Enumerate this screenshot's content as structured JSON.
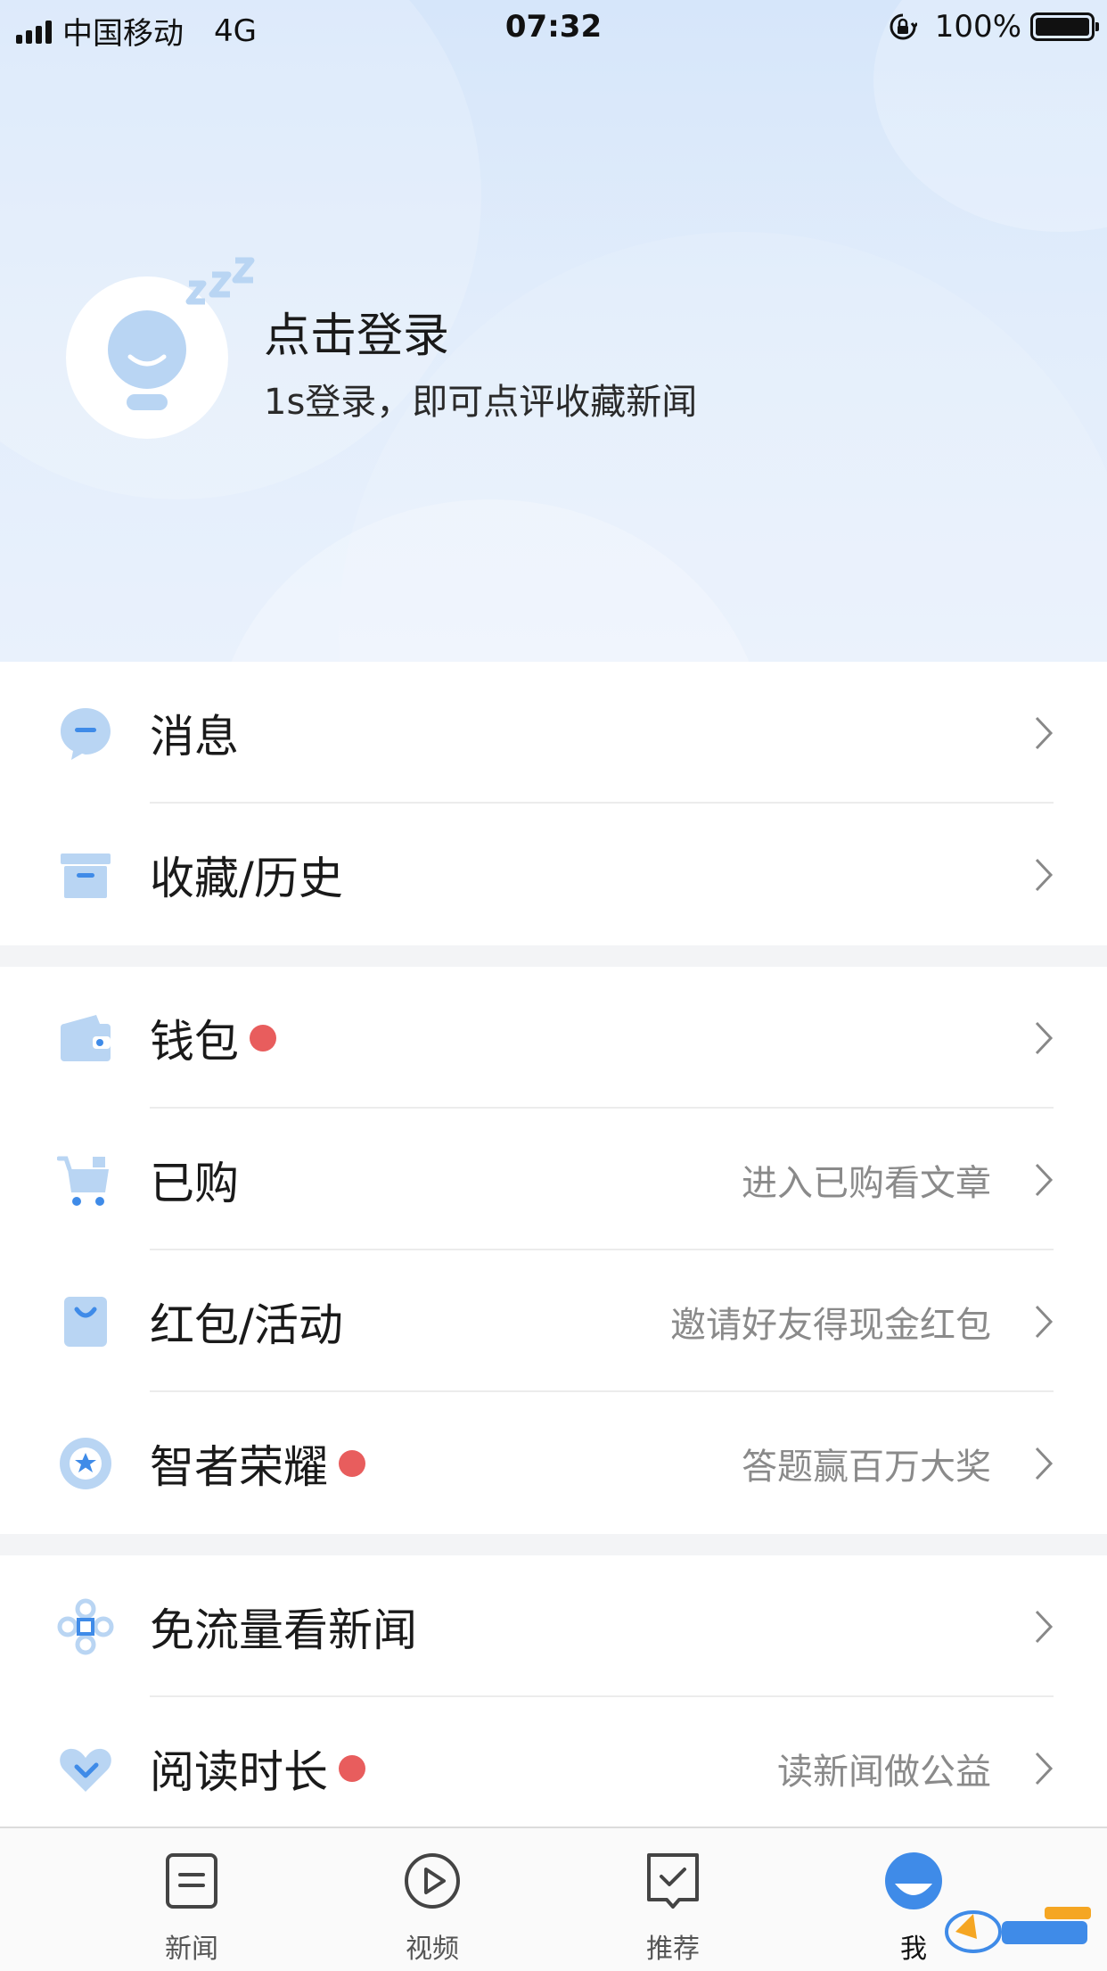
{
  "status_bar": {
    "carrier": "中国移动",
    "network": "4G",
    "time": "07:32",
    "battery": "100%"
  },
  "profile": {
    "title": "点击登录",
    "subtitle": "1s登录，即可点评收藏新闻"
  },
  "menu_groups": [
    [
      {
        "label": "消息",
        "hint": "",
        "dot": false,
        "icon": "message-icon"
      },
      {
        "label": "收藏/历史",
        "hint": "",
        "dot": false,
        "icon": "archive-box-icon"
      }
    ],
    [
      {
        "label": "钱包",
        "hint": "",
        "dot": true,
        "icon": "wallet-icon"
      },
      {
        "label": "已购",
        "hint": "进入已购看文章",
        "dot": false,
        "icon": "shopping-cart-icon"
      },
      {
        "label": "红包/活动",
        "hint": "邀请好友得现金红包",
        "dot": false,
        "icon": "red-packet-icon"
      },
      {
        "label": "智者荣耀",
        "hint": "答题赢百万大奖",
        "dot": true,
        "icon": "badge-star-icon"
      }
    ],
    [
      {
        "label": "免流量看新闻",
        "hint": "",
        "dot": false,
        "icon": "china-unicom-knot-icon"
      },
      {
        "label": "阅读时长",
        "hint": "读新闻做公益",
        "dot": true,
        "icon": "heart-hand-icon"
      }
    ]
  ],
  "tabs": [
    {
      "label": "新闻",
      "icon": "news-doc-icon",
      "active": false
    },
    {
      "label": "视频",
      "icon": "play-circle-icon",
      "active": false
    },
    {
      "label": "推荐",
      "icon": "recommend-check-icon",
      "active": false
    },
    {
      "label": "我",
      "icon": "profile-face-icon",
      "active": true
    }
  ],
  "colors": {
    "accent_blue": "#3f8be8",
    "icon_light_blue": "#b9d5f3",
    "notification_dot": "#e85d5d",
    "header_gradient_top": "#d6e6fa"
  }
}
